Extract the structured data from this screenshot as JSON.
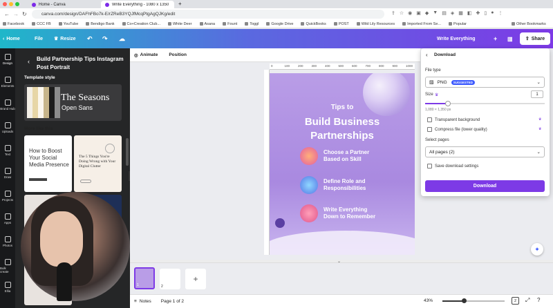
{
  "browser": {
    "tabs": [
      {
        "label": "Home - Canva"
      },
      {
        "label": "Write Everything - 1080 x 1350"
      }
    ],
    "url": "canva.com/design/DAFhFBo7k-E/rZReB3YQJfMcqPtgAgQJKg/edit",
    "bookmarks": [
      "Facebook",
      "CCC FB",
      "YouTube",
      "Bendigo Bank",
      "Co+Creation Club...",
      "White Deer",
      "Asana",
      "Fount",
      "Toggl",
      "Google Drive",
      "QuickBooks",
      "POST",
      "Wild Lily Resources",
      "Imported From Se...",
      "Popular"
    ],
    "other_bookmarks": "Other Bookmarks"
  },
  "header": {
    "home": "Home",
    "file": "File",
    "resize": "Resize",
    "doc_title": "Write Everything",
    "share": "Share"
  },
  "rail": [
    "Design",
    "Elements",
    "Brand Hub",
    "Uploads",
    "Text",
    "Draw",
    "Projects",
    "Apps",
    "Photos",
    "Bulk create",
    "Ellia"
  ],
  "panel": {
    "title": "Build Partnership Tips Instagram Post Portrait",
    "template_style": "Template style",
    "font_heading": "The Seasons",
    "font_body": "Open Sans",
    "more_like_this": "More like this",
    "thumb1": "How to Boost Your Social Media Presence",
    "thumb2": "The 5 Things You're Doing Wrong with Your Digital Clutter"
  },
  "toolbar": {
    "animate": "Animate",
    "position": "Position"
  },
  "ruler_ticks": [
    "0",
    "100",
    "200",
    "300",
    "400",
    "500",
    "600",
    "700",
    "800",
    "900",
    "1000"
  ],
  "design": {
    "tips_to": "Tips to",
    "title_line1": "Build Business",
    "title_line2": "Partnerships",
    "steps": [
      {
        "line1": "Choose a Partner",
        "line2": "Based on Skill"
      },
      {
        "line1": "Define Role and",
        "line2": "Responsibilities"
      },
      {
        "line1": "Write Everything",
        "line2": "Down to Remember"
      }
    ]
  },
  "download": {
    "title": "Download",
    "file_type_label": "File type",
    "file_type": "PNG",
    "badge": "SUGGESTED",
    "size_label": "Size",
    "size_value": "1",
    "dimensions": "1,080 × 1,350 px",
    "transparent": "Transparent background",
    "compress": "Compress file (lower quality)",
    "select_pages_label": "Select pages",
    "pages": "All pages (2)",
    "save_settings": "Save download settings",
    "button": "Download"
  },
  "footer": {
    "notes": "Notes",
    "page": "Page 1 of 2",
    "zoom": "43%",
    "pages_count": "2",
    "page_numbers": [
      "1",
      "2"
    ]
  },
  "colors": {
    "accent": "#7d3ae6",
    "header_start": "#1fb7c9",
    "design_bg": "#b99de7"
  }
}
